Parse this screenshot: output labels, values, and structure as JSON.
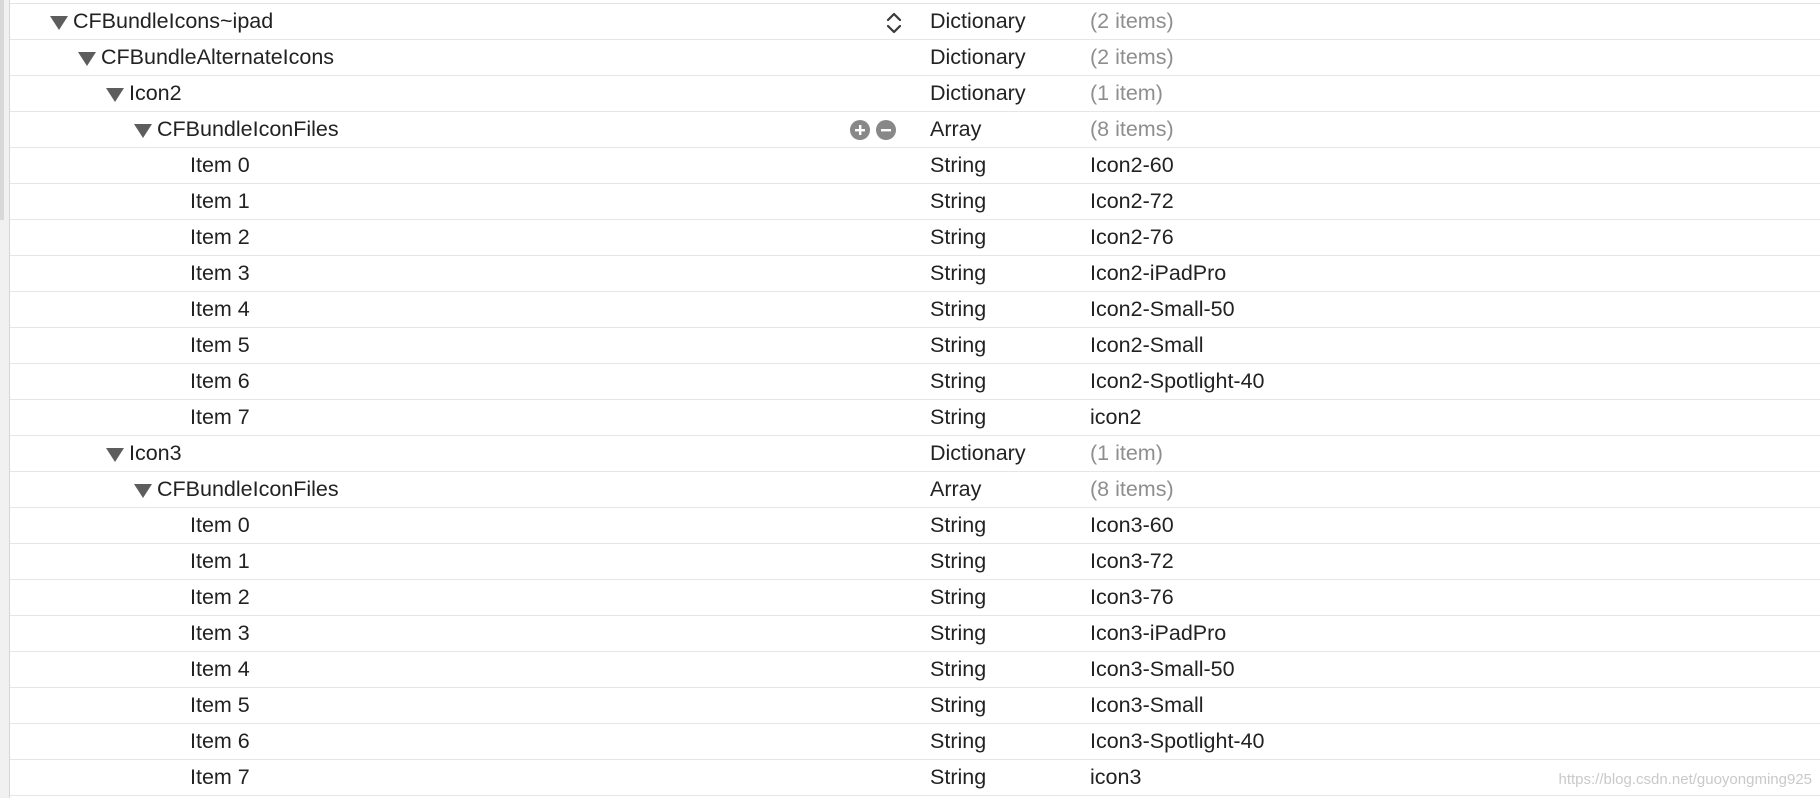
{
  "rows": [
    {
      "key": "CFBundleIcons~ipad",
      "type": "Dictionary",
      "value": "(2 items)",
      "depth": 1,
      "expanded": true,
      "muted": true
    },
    {
      "key": "CFBundleAlternateIcons",
      "type": "Dictionary",
      "value": "(2 items)",
      "depth": 2,
      "expanded": true,
      "muted": true
    },
    {
      "key": "Icon2",
      "type": "Dictionary",
      "value": "(1 item)",
      "depth": 3,
      "expanded": true,
      "muted": true
    },
    {
      "key": "CFBundleIconFiles",
      "type": "Array",
      "value": "(8 items)",
      "depth": 4,
      "expanded": true,
      "muted": true
    },
    {
      "key": "Item 0",
      "type": "String",
      "value": "Icon2-60",
      "depth": 5
    },
    {
      "key": "Item 1",
      "type": "String",
      "value": "Icon2-72",
      "depth": 5
    },
    {
      "key": "Item 2",
      "type": "String",
      "value": "Icon2-76",
      "depth": 5
    },
    {
      "key": "Item 3",
      "type": "String",
      "value": "Icon2-iPadPro",
      "depth": 5
    },
    {
      "key": "Item 4",
      "type": "String",
      "value": "Icon2-Small-50",
      "depth": 5
    },
    {
      "key": "Item 5",
      "type": "String",
      "value": "Icon2-Small",
      "depth": 5
    },
    {
      "key": "Item 6",
      "type": "String",
      "value": "Icon2-Spotlight-40",
      "depth": 5
    },
    {
      "key": "Item 7",
      "type": "String",
      "value": "icon2",
      "depth": 5
    },
    {
      "key": "Icon3",
      "type": "Dictionary",
      "value": "(1 item)",
      "depth": 3,
      "expanded": true,
      "muted": true
    },
    {
      "key": "CFBundleIconFiles",
      "type": "Array",
      "value": "(8 items)",
      "depth": 4,
      "expanded": true,
      "muted": true
    },
    {
      "key": "Item 0",
      "type": "String",
      "value": "Icon3-60",
      "depth": 5
    },
    {
      "key": "Item 1",
      "type": "String",
      "value": "Icon3-72",
      "depth": 5
    },
    {
      "key": "Item 2",
      "type": "String",
      "value": "Icon3-76",
      "depth": 5
    },
    {
      "key": "Item 3",
      "type": "String",
      "value": "Icon3-iPadPro",
      "depth": 5
    },
    {
      "key": "Item 4",
      "type": "String",
      "value": "Icon3-Small-50",
      "depth": 5
    },
    {
      "key": "Item 5",
      "type": "String",
      "value": "Icon3-Small",
      "depth": 5
    },
    {
      "key": "Item 6",
      "type": "String",
      "value": "Icon3-Spotlight-40",
      "depth": 5
    },
    {
      "key": "Item 7",
      "type": "String",
      "value": "icon3",
      "depth": 5
    }
  ],
  "row_controls": {
    "0": "type-stepper-icon",
    "3": [
      "add-icon",
      "remove-icon"
    ]
  },
  "watermark": "https://blog.csdn.net/guoyongming925",
  "colors": {
    "text": "#222222",
    "muted": "#8e8e8e",
    "separator": "#e6e6e6",
    "disclosure": "#5d5d5d",
    "button": "#888888"
  }
}
